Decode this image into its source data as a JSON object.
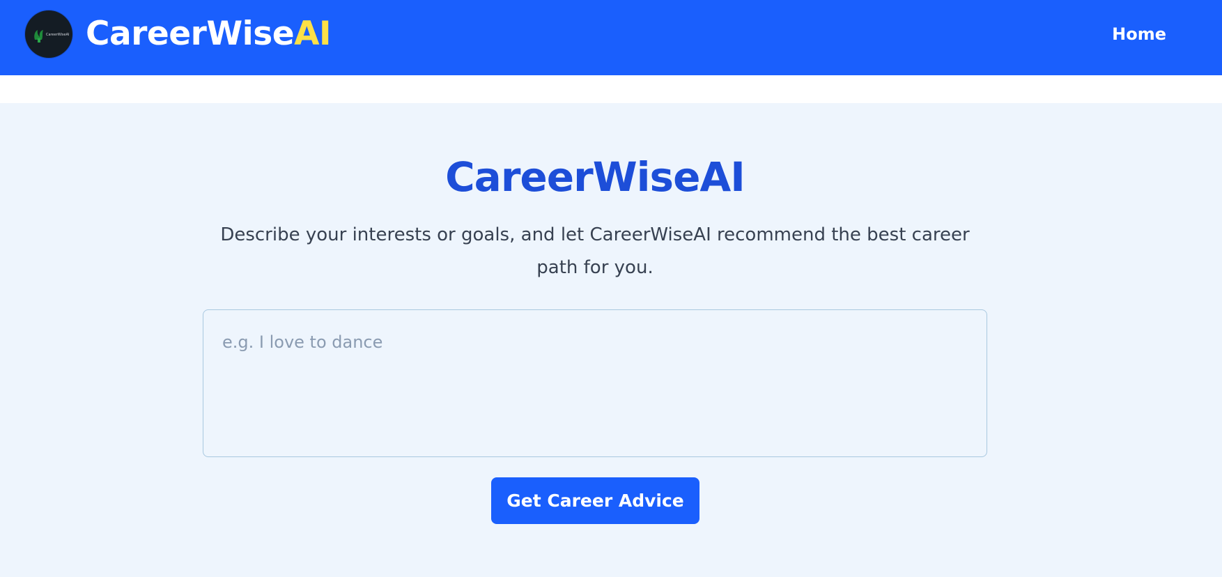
{
  "header": {
    "logo_text": "CareerWiseAI",
    "brand_main": "CareerWise",
    "brand_accent": "AI",
    "nav_home": "Home"
  },
  "hero": {
    "title": "CareerWiseAI",
    "subtitle": "Describe your interests or goals, and let CareerWiseAI recommend the best career path for you."
  },
  "form": {
    "input_placeholder": "e.g. I love to dance",
    "input_value": "",
    "submit_label": "Get Career Advice"
  },
  "colors": {
    "brand_blue": "#1a5ffd",
    "accent_yellow": "#fde047",
    "title_blue": "#1d4ed8",
    "page_background": "#eef5fd"
  },
  "icons": {
    "logo": "tree-logo-icon"
  }
}
